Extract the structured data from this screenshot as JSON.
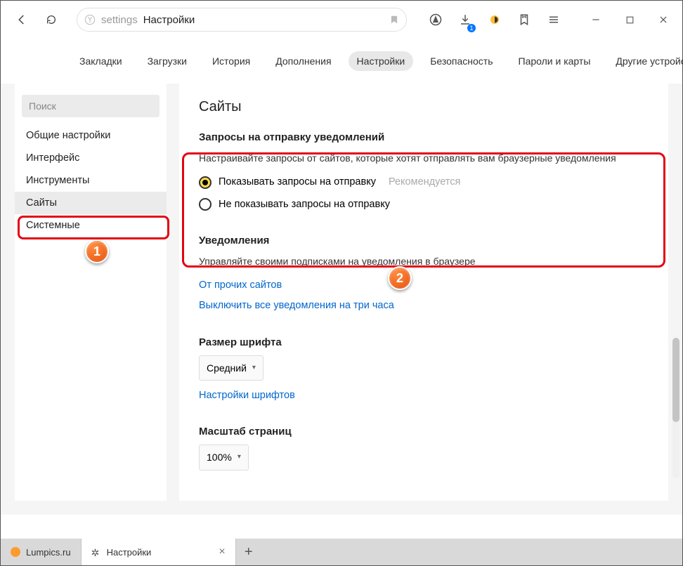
{
  "address": {
    "t1": "settings",
    "t2": "Настройки"
  },
  "tabs": [
    "Закладки",
    "Загрузки",
    "История",
    "Дополнения",
    "Настройки",
    "Безопасность",
    "Пароли и карты",
    "Другие устройства"
  ],
  "activeTabIndex": 4,
  "sidebar": {
    "searchPlaceholder": "Поиск",
    "items": [
      "Общие настройки",
      "Интерфейс",
      "Инструменты",
      "Сайты",
      "Системные"
    ],
    "activeIndex": 3
  },
  "page": {
    "title": "Сайты",
    "sections": {
      "requests": {
        "title": "Запросы на отправку уведомлений",
        "desc": "Настраивайте запросы от сайтов, которые хотят отправлять вам браузерные уведомления",
        "opt1": "Показывать запросы на отправку",
        "opt1reco": "Рекомендуется",
        "opt2": "Не показывать запросы на отправку"
      },
      "notifications": {
        "title": "Уведомления",
        "desc": "Управляйте своими подписками на уведомления в браузере",
        "link1": "От прочих сайтов",
        "link2": "Выключить все уведомления на три часа"
      },
      "font": {
        "title": "Размер шрифта",
        "value": "Средний",
        "link": "Настройки шрифтов"
      },
      "zoom": {
        "title": "Масштаб страниц",
        "value": "100%"
      }
    }
  },
  "markers": {
    "m1": "1",
    "m2": "2"
  },
  "bottomTabs": {
    "t1": "Lumpics.ru",
    "t2": "Настройки"
  }
}
